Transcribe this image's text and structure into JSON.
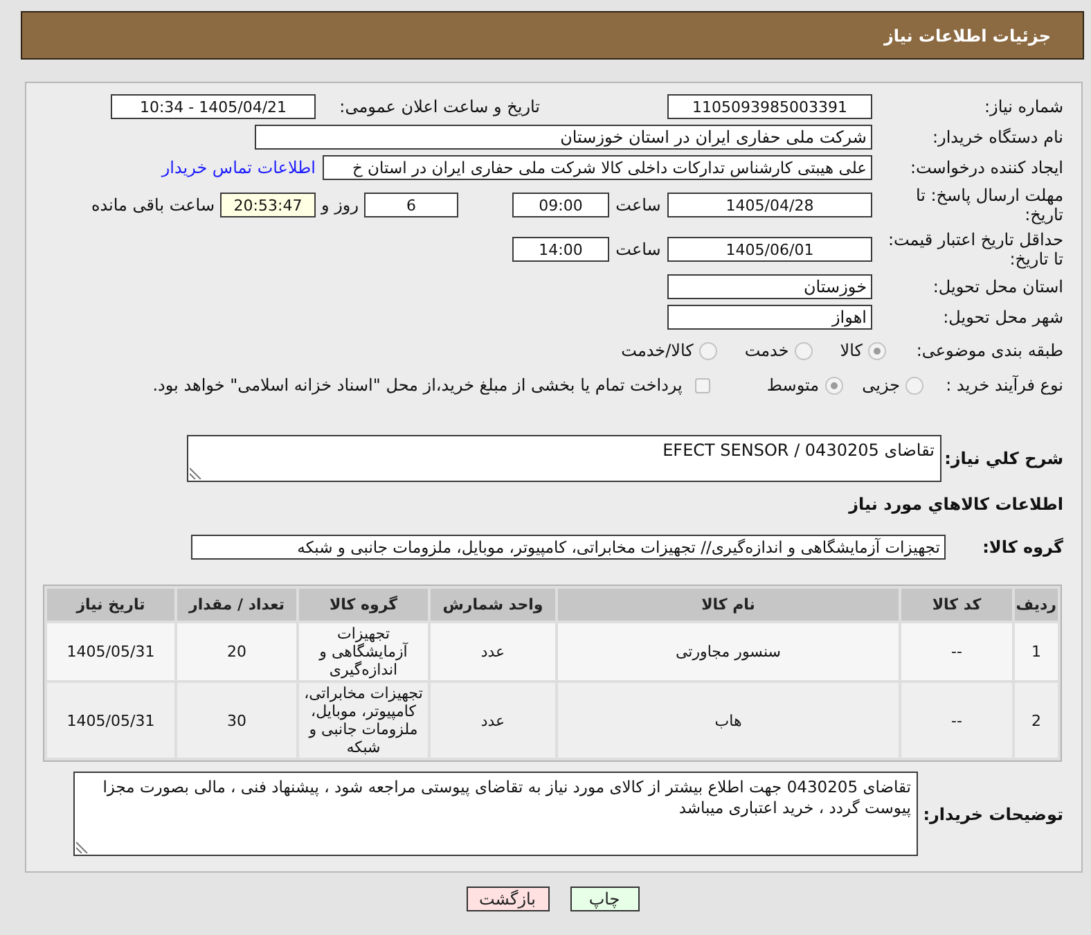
{
  "header": {
    "title": "جزئیات اطلاعات نیاز"
  },
  "need_number": {
    "label": "شماره نیاز:",
    "value": "1105093985003391"
  },
  "announcement": {
    "label": "تاریخ و ساعت اعلان عمومی:",
    "value": "1405/04/21 - 10:34"
  },
  "buyer_org": {
    "label": "نام دستگاه خریدار:",
    "value": "شرکت ملی حفاری ایران در استان خوزستان"
  },
  "requester": {
    "label": "ایجاد کننده درخواست:",
    "value": "علی هیبتی کارشناس تدارکات داخلی کالا شرکت ملی حفاری ایران در استان خ",
    "link": "اطلاعات تماس خریدار"
  },
  "reply_deadline": {
    "label": "مهلت ارسال پاسخ: تا تاریخ:",
    "date": "1405/04/28",
    "time_label": "ساعت",
    "time": "09:00",
    "days": "6",
    "days_label": "روز و",
    "remaining": "20:53:47",
    "remaining_label": "ساعت باقی مانده"
  },
  "price_validity": {
    "label": "حداقل تاریخ اعتبار قیمت: تا تاریخ:",
    "date": "1405/06/01",
    "time_label": "ساعت",
    "time": "14:00"
  },
  "delivery_province": {
    "label": "استان محل تحویل:",
    "value": "خوزستان"
  },
  "delivery_city": {
    "label": "شهر محل تحویل:",
    "value": "اهواز"
  },
  "category": {
    "label": "طبقه بندی موضوعی:",
    "disabled": true,
    "options": [
      {
        "label": "کالا",
        "selected": true
      },
      {
        "label": "خدمت",
        "selected": false
      },
      {
        "label": "کالا/خدمت",
        "selected": false
      }
    ]
  },
  "purchase_process": {
    "label": "نوع فرآیند خرید :",
    "disabled": true,
    "options": [
      {
        "label": "جزیی",
        "selected": false
      },
      {
        "label": "متوسط",
        "selected": true
      }
    ],
    "treasury": {
      "label": "پرداخت تمام یا بخشی از مبلغ خرید،از محل \"اسناد خزانه اسلامی\" خواهد بود.",
      "checked": false
    }
  },
  "description": {
    "label": "شرح کلي نياز:",
    "value": "تقاضای 0430205 / EFECT SENSOR"
  },
  "goods_section": {
    "heading": "اطلاعات كالاهاي مورد نياز",
    "group_label": "گروه کالا:",
    "group_value": "تجهیزات آزمایشگاهی و اندازه‌گیری// تجهیزات مخابراتی، کامپیوتر، موبایل، ملزومات جانبی و شبکه"
  },
  "table": {
    "columns": [
      "ردیف",
      "کد کالا",
      "نام کالا",
      "واحد شمارش",
      "گروه کالا",
      "تعداد / مقدار",
      "تاریخ نیاز"
    ],
    "rows": [
      {
        "cells": [
          "1",
          "--",
          "سنسور مجاورتی",
          "عدد",
          "تجهیزات آزمایشگاهی و اندازه‌گیری",
          "20",
          "1405/05/31"
        ]
      },
      {
        "cells": [
          "2",
          "--",
          "هاب",
          "عدد",
          "تجهیزات مخابراتی، کامپیوتر، موبایل، ملزومات جانبی و شبکه",
          "30",
          "1405/05/31"
        ]
      }
    ]
  },
  "buyer_notes": {
    "label": "توضیحات خریدار:",
    "value": "تقاضای 0430205 جهت اطلاع بیشتر از کالای مورد نیاز به تقاضای پیوستی مراجعه شود ، پیشنهاد فنی ، مالی بصورت مجزا پیوست گردد ، خرید اعتباری میباشد"
  },
  "buttons": [
    {
      "kind": "print",
      "label": "چاپ"
    },
    {
      "kind": "back",
      "label": "بازگشت"
    }
  ]
}
